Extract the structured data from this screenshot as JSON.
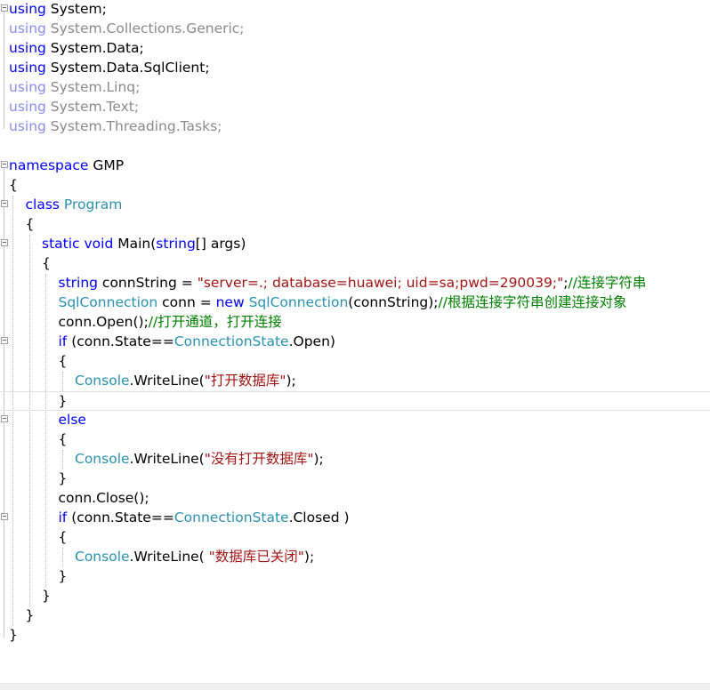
{
  "editor": {
    "lines": [
      {
        "indent": 0,
        "fold": true,
        "faded": false,
        "tokens": [
          {
            "t": "using",
            "c": "kw"
          },
          {
            "t": " System;",
            "c": ""
          }
        ]
      },
      {
        "indent": 0,
        "fold": false,
        "faded": true,
        "tokens": [
          {
            "t": "using",
            "c": "kw"
          },
          {
            "t": " System.Collections.Generic;",
            "c": ""
          }
        ]
      },
      {
        "indent": 0,
        "fold": false,
        "faded": false,
        "tokens": [
          {
            "t": "using",
            "c": "kw"
          },
          {
            "t": " System.Data;",
            "c": ""
          }
        ]
      },
      {
        "indent": 0,
        "fold": false,
        "faded": false,
        "tokens": [
          {
            "t": "using",
            "c": "kw"
          },
          {
            "t": " System.Data.SqlClient;",
            "c": ""
          }
        ]
      },
      {
        "indent": 0,
        "fold": false,
        "faded": true,
        "tokens": [
          {
            "t": "using",
            "c": "kw"
          },
          {
            "t": " System.Linq;",
            "c": ""
          }
        ]
      },
      {
        "indent": 0,
        "fold": false,
        "faded": true,
        "tokens": [
          {
            "t": "using",
            "c": "kw"
          },
          {
            "t": " System.Text;",
            "c": ""
          }
        ]
      },
      {
        "indent": 0,
        "fold": false,
        "faded": true,
        "tokens": [
          {
            "t": "using",
            "c": "kw"
          },
          {
            "t": " System.Threading.Tasks;",
            "c": ""
          }
        ]
      },
      {
        "indent": 0,
        "fold": false,
        "faded": false,
        "tokens": []
      },
      {
        "indent": 0,
        "fold": true,
        "faded": false,
        "tokens": [
          {
            "t": "namespace",
            "c": "kw"
          },
          {
            "t": " GMP",
            "c": ""
          }
        ]
      },
      {
        "indent": 0,
        "fold": false,
        "faded": false,
        "tokens": [
          {
            "t": "{",
            "c": ""
          }
        ]
      },
      {
        "indent": 1,
        "fold": true,
        "faded": false,
        "tokens": [
          {
            "t": "class",
            "c": "kw"
          },
          {
            "t": " ",
            "c": ""
          },
          {
            "t": "Program",
            "c": "type"
          }
        ]
      },
      {
        "indent": 1,
        "fold": false,
        "faded": false,
        "tokens": [
          {
            "t": "{",
            "c": ""
          }
        ]
      },
      {
        "indent": 2,
        "fold": true,
        "faded": false,
        "tokens": [
          {
            "t": "static",
            "c": "kw"
          },
          {
            "t": " ",
            "c": ""
          },
          {
            "t": "void",
            "c": "kw"
          },
          {
            "t": " Main(",
            "c": ""
          },
          {
            "t": "string",
            "c": "kw"
          },
          {
            "t": "[] args)",
            "c": ""
          }
        ]
      },
      {
        "indent": 2,
        "fold": false,
        "faded": false,
        "tokens": [
          {
            "t": "{",
            "c": ""
          }
        ]
      },
      {
        "indent": 3,
        "fold": false,
        "faded": false,
        "tokens": [
          {
            "t": "string",
            "c": "kw"
          },
          {
            "t": " connString = ",
            "c": ""
          },
          {
            "t": "\"server=.; database=huawei; uid=sa;pwd=290039;\"",
            "c": "str"
          },
          {
            "t": ";",
            "c": ""
          },
          {
            "t": "//连接字符串",
            "c": "cmt"
          }
        ]
      },
      {
        "indent": 3,
        "fold": false,
        "faded": false,
        "tokens": [
          {
            "t": "SqlConnection",
            "c": "type"
          },
          {
            "t": " conn = ",
            "c": ""
          },
          {
            "t": "new",
            "c": "kw"
          },
          {
            "t": " ",
            "c": ""
          },
          {
            "t": "SqlConnection",
            "c": "type"
          },
          {
            "t": "(connString);",
            "c": ""
          },
          {
            "t": "//根据连接字符串创建连接对象",
            "c": "cmt"
          }
        ]
      },
      {
        "indent": 3,
        "fold": false,
        "faded": false,
        "tokens": [
          {
            "t": "conn.Open();",
            "c": ""
          },
          {
            "t": "//打开通道，打开连接",
            "c": "cmt"
          }
        ]
      },
      {
        "indent": 3,
        "fold": true,
        "faded": false,
        "tokens": [
          {
            "t": "if",
            "c": "kw"
          },
          {
            "t": " (conn.State==",
            "c": ""
          },
          {
            "t": "ConnectionState",
            "c": "type"
          },
          {
            "t": ".Open)",
            "c": ""
          }
        ]
      },
      {
        "indent": 3,
        "fold": false,
        "faded": false,
        "tokens": [
          {
            "t": "{",
            "c": ""
          }
        ]
      },
      {
        "indent": 4,
        "fold": false,
        "faded": false,
        "tokens": [
          {
            "t": "Console",
            "c": "type"
          },
          {
            "t": ".WriteLine(",
            "c": ""
          },
          {
            "t": "\"打开数据库\"",
            "c": "str"
          },
          {
            "t": ");",
            "c": ""
          }
        ]
      },
      {
        "indent": 3,
        "fold": false,
        "faded": false,
        "current": true,
        "tokens": [
          {
            "t": "}",
            "c": ""
          }
        ]
      },
      {
        "indent": 3,
        "fold": true,
        "faded": false,
        "tokens": [
          {
            "t": "else",
            "c": "kw"
          }
        ]
      },
      {
        "indent": 3,
        "fold": false,
        "faded": false,
        "tokens": [
          {
            "t": "{",
            "c": ""
          }
        ]
      },
      {
        "indent": 4,
        "fold": false,
        "faded": false,
        "tokens": [
          {
            "t": "Console",
            "c": "type"
          },
          {
            "t": ".WriteLine(",
            "c": ""
          },
          {
            "t": "\"没有打开数据库\"",
            "c": "str"
          },
          {
            "t": ");",
            "c": ""
          }
        ]
      },
      {
        "indent": 3,
        "fold": false,
        "faded": false,
        "tokens": [
          {
            "t": "}",
            "c": ""
          }
        ]
      },
      {
        "indent": 3,
        "fold": false,
        "faded": false,
        "tokens": [
          {
            "t": "conn.Close();",
            "c": ""
          }
        ]
      },
      {
        "indent": 3,
        "fold": true,
        "faded": false,
        "tokens": [
          {
            "t": "if",
            "c": "kw"
          },
          {
            "t": " (conn.State==",
            "c": ""
          },
          {
            "t": "ConnectionState",
            "c": "type"
          },
          {
            "t": ".Closed )",
            "c": ""
          }
        ]
      },
      {
        "indent": 3,
        "fold": false,
        "faded": false,
        "tokens": [
          {
            "t": "{",
            "c": ""
          }
        ]
      },
      {
        "indent": 4,
        "fold": false,
        "faded": false,
        "tokens": [
          {
            "t": "Console",
            "c": "type"
          },
          {
            "t": ".WriteLine( ",
            "c": ""
          },
          {
            "t": "\"数据库已关闭\"",
            "c": "str"
          },
          {
            "t": ");",
            "c": ""
          }
        ]
      },
      {
        "indent": 3,
        "fold": false,
        "faded": false,
        "tokens": [
          {
            "t": "}",
            "c": ""
          }
        ]
      },
      {
        "indent": 2,
        "fold": false,
        "faded": false,
        "tokens": [
          {
            "t": "}",
            "c": ""
          }
        ]
      },
      {
        "indent": 1,
        "fold": false,
        "faded": false,
        "tokens": [
          {
            "t": "}",
            "c": ""
          }
        ]
      },
      {
        "indent": 0,
        "fold": false,
        "faded": false,
        "tokens": [
          {
            "t": "}",
            "c": ""
          }
        ]
      }
    ]
  },
  "colors": {
    "keyword": "#0000ff",
    "type": "#2b91af",
    "string": "#a31515",
    "comment": "#008000",
    "text": "#000000"
  }
}
